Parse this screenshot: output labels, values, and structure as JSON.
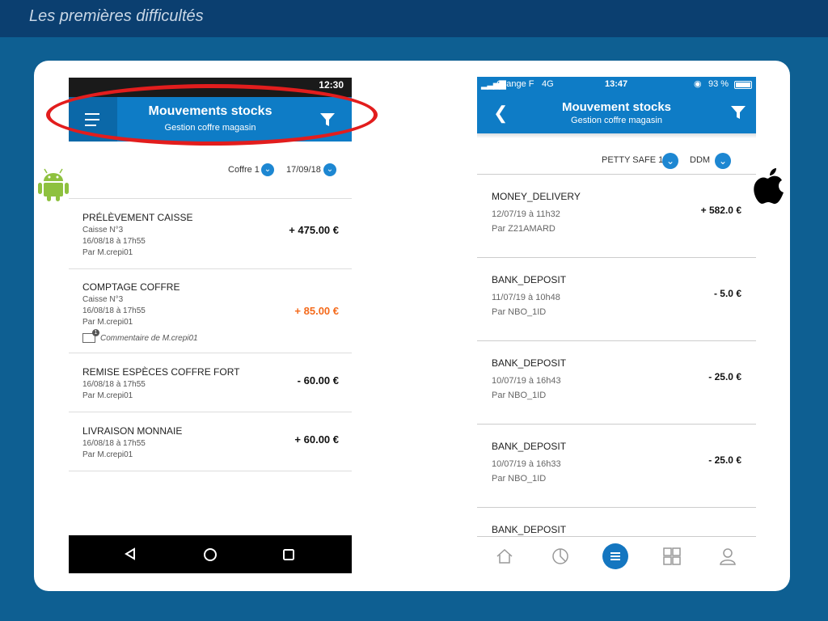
{
  "slide": {
    "title": "Les premières difficultés"
  },
  "android": {
    "status_time": "12:30",
    "header": {
      "title": "Mouvements stocks",
      "subtitle": "Gestion coffre magasin"
    },
    "filters": {
      "safe": "Coffre 1",
      "date": "17/09/18"
    },
    "items": [
      {
        "title": "PRÉLÈVEMENT CAISSE",
        "lines": [
          "Caisse N°3",
          "16/08/18 à 17h55",
          "Par M.crepi01"
        ],
        "amount": "+ 475.00 €"
      },
      {
        "title": "COMPTAGE COFFRE",
        "lines": [
          "Caisse N°3",
          "16/08/18 à 17h55",
          "Par M.crepi01"
        ],
        "amount": "+ 85.00 €",
        "comment": "Commentaire de M.crepi01",
        "comment_count": "1"
      },
      {
        "title": "REMISE ESPÈCES COFFRE FORT",
        "lines": [
          "16/08/18 à 17h55",
          "Par M.crepi01"
        ],
        "amount": "- 60.00 €"
      },
      {
        "title": "LIVRAISON MONNAIE",
        "lines": [
          "16/08/18 à 17h55",
          "Par M.crepi01"
        ],
        "amount": "+ 60.00 €"
      }
    ]
  },
  "ios": {
    "status": {
      "carrier": "Orange F",
      "network": "4G",
      "time": "13:47",
      "battery": "93 %"
    },
    "header": {
      "title": "Mouvement stocks",
      "subtitle": "Gestion coffre magasin"
    },
    "filters": {
      "safe": "PETTY SAFE 1",
      "sort": "DDM"
    },
    "items": [
      {
        "title": "MONEY_DELIVERY",
        "date": "12/07/19 à 11h32",
        "by": "Par Z21AMARD",
        "amount": "+ 582.0 €"
      },
      {
        "title": "BANK_DEPOSIT",
        "date": "11/07/19 à 10h48",
        "by": "Par NBO_1ID",
        "amount": "- 5.0 €"
      },
      {
        "title": "BANK_DEPOSIT",
        "date": "10/07/19 à 16h43",
        "by": "Par NBO_1ID",
        "amount": "- 25.0 €"
      },
      {
        "title": "BANK_DEPOSIT",
        "date": "10/07/19 à 16h33",
        "by": "Par NBO_1ID",
        "amount": "- 25.0 €"
      },
      {
        "title": "BANK_DEPOSIT",
        "date": "",
        "by": "",
        "amount": ""
      }
    ],
    "tabs": [
      "home-icon",
      "chart-icon",
      "menu-icon",
      "grid-icon",
      "user-icon"
    ]
  },
  "colors": {
    "brand_blue": "#0e7cc6",
    "orange_amount": "#f46a1b",
    "highlight_red": "#e21d1d"
  }
}
